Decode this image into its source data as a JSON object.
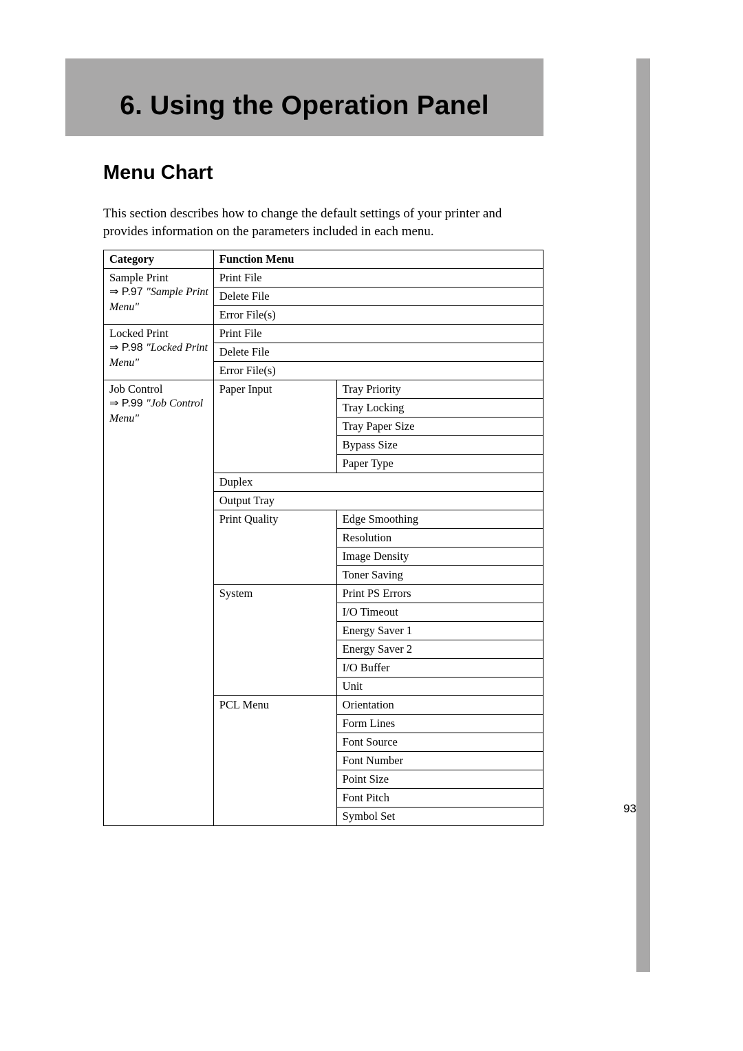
{
  "chapter_title": "6. Using the Operation Panel",
  "section_title": "Menu Chart",
  "intro_text": "This section describes how to change the default settings of your printer and provides information on the parameters included in each menu.",
  "headers": {
    "category": "Category",
    "function": "Function Menu"
  },
  "categories": [
    {
      "name": "Sample Print",
      "ref_prefix": "⇒ P.97 ",
      "ref_title": "\"Sample Print Menu\"",
      "items": [
        {
          "fn": "Print File",
          "subs": []
        },
        {
          "fn": "Delete File",
          "subs": []
        },
        {
          "fn": "Error File(s)",
          "subs": []
        }
      ]
    },
    {
      "name": "Locked Print",
      "ref_prefix": "⇒ P.98 ",
      "ref_title": "\"Locked Print Menu\"",
      "items": [
        {
          "fn": "Print File",
          "subs": []
        },
        {
          "fn": "Delete File",
          "subs": []
        },
        {
          "fn": "Error File(s)",
          "subs": []
        }
      ]
    },
    {
      "name": "Job Control",
      "ref_prefix": "⇒ P.99 ",
      "ref_title": "\"Job Control Menu\"",
      "items": [
        {
          "fn": "Paper Input",
          "subs": [
            "Tray Priority",
            "Tray Locking",
            "Tray Paper Size",
            "Bypass Size",
            "Paper Type"
          ]
        },
        {
          "fn": "Duplex",
          "subs": []
        },
        {
          "fn": "Output Tray",
          "subs": []
        },
        {
          "fn": "Print Quality",
          "subs": [
            "Edge Smoothing",
            "Resolution",
            "Image Density",
            "Toner Saving"
          ]
        },
        {
          "fn": "System",
          "subs": [
            "Print PS Errors",
            "I/O Timeout",
            "Energy Saver 1",
            "Energy Saver 2",
            "I/O Buffer",
            "Unit"
          ]
        },
        {
          "fn": "PCL Menu",
          "subs": [
            "Orientation",
            "Form Lines",
            "Font Source",
            "Font Number",
            "Point Size",
            "Font Pitch",
            "Symbol Set"
          ]
        }
      ]
    }
  ],
  "page_number": "93"
}
